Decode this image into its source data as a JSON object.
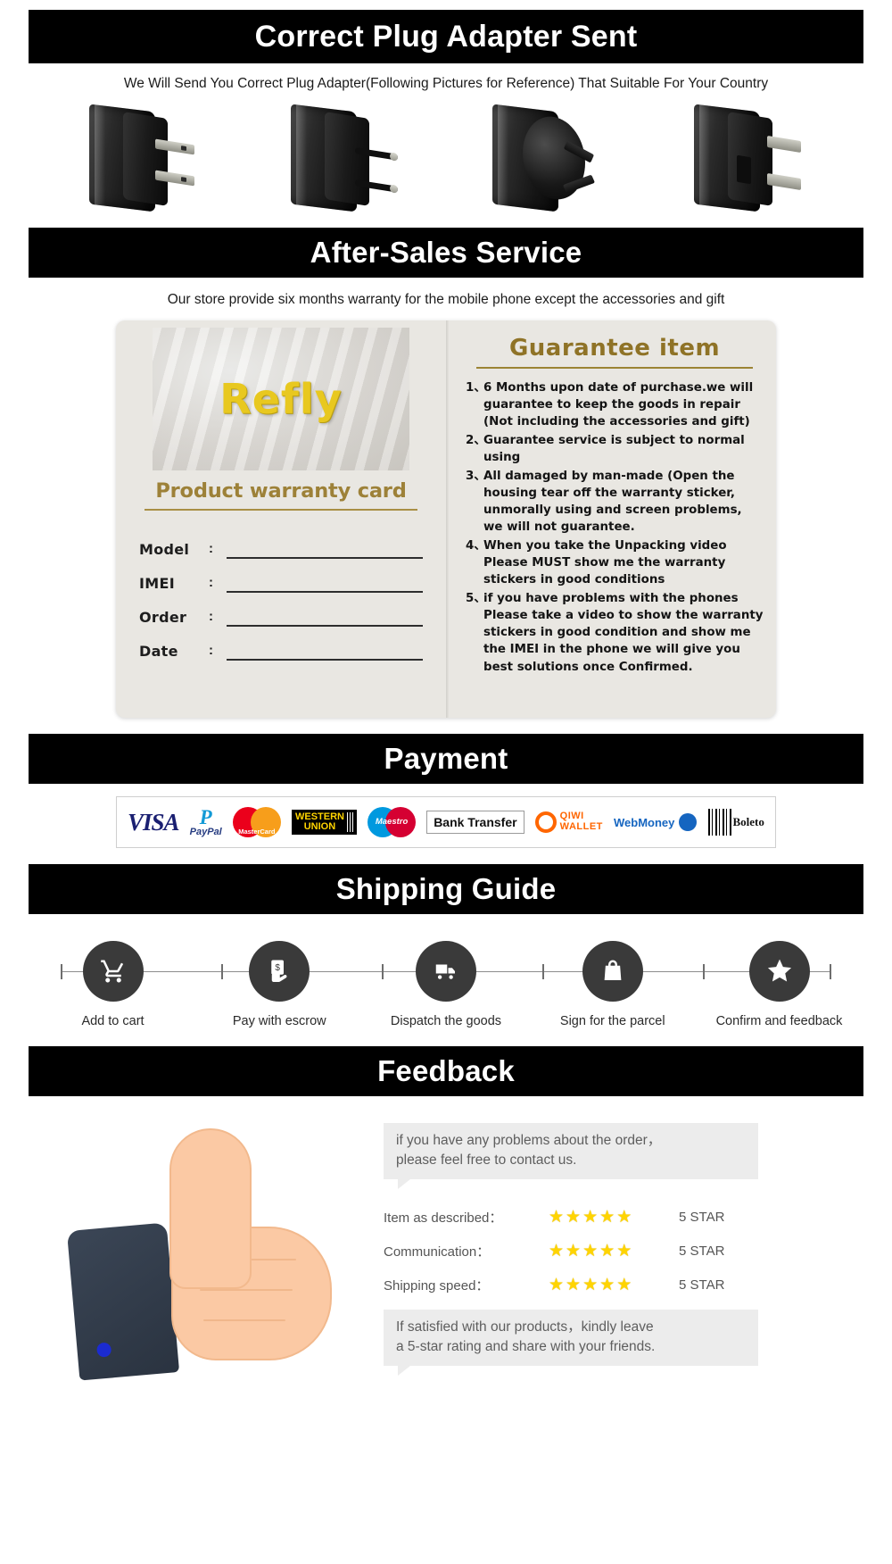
{
  "sections": {
    "plug": {
      "title": "Correct Plug Adapter Sent",
      "subtitle": "We Will Send You Correct Plug Adapter(Following Pictures for Reference) That Suitable For Your Country",
      "adapters": [
        {
          "name": "us-plug-adapter"
        },
        {
          "name": "eu-plug-adapter"
        },
        {
          "name": "au-plug-adapter"
        },
        {
          "name": "uk-plug-adapter"
        }
      ]
    },
    "after_sales": {
      "title": "After-Sales Service",
      "subtitle": "Our store provide  six months warranty  for the mobile  phone  except the  accessories and gift",
      "card": {
        "brand": "Refly",
        "card_title": "Product warranty card",
        "fields": [
          {
            "label": "Model",
            "colon": ":",
            "value": ""
          },
          {
            "label": "IMEI",
            "colon": ":",
            "value": ""
          },
          {
            "label": "Order",
            "colon": ":",
            "value": ""
          },
          {
            "label": "Date",
            "colon": ":",
            "value": ""
          }
        ],
        "guarantee_title": "Guarantee  item",
        "guarantee_items": [
          {
            "num": "1、",
            "text": "6 Months upon date of purchase.we will guarantee to keep the goods in repair (Not including the accessories and gift)"
          },
          {
            "num": "2、",
            "text": "Guarantee service is subject to normal using"
          },
          {
            "num": "3、",
            "text": "All damaged by man-made (Open the housing tear off the warranty sticker, unmorally using and screen problems, we will not guarantee."
          },
          {
            "num": "4、",
            "text": "When you take the Unpacking video Please MUST show me the warranty stickers in good conditions"
          },
          {
            "num": "5、",
            "text": "if you have problems with the phones Please take a video to show the warranty stickers in good condition and show me the IMEI in the phone we will give you best solutions once  Confirmed."
          }
        ]
      }
    },
    "payment": {
      "title": "Payment",
      "methods": [
        {
          "name": "visa-logo",
          "label": "VISA"
        },
        {
          "name": "paypal-logo",
          "label": "PayPal"
        },
        {
          "name": "mastercard-logo",
          "label": "MasterCard"
        },
        {
          "name": "western-union-logo",
          "label": "WESTERN",
          "label2": "UNION"
        },
        {
          "name": "maestro-logo",
          "label": "Maestro"
        },
        {
          "name": "bank-transfer-logo",
          "label": "Bank Transfer"
        },
        {
          "name": "qiwi-wallet-logo",
          "label": "QIWI",
          "label2": "WALLET"
        },
        {
          "name": "webmoney-logo",
          "label": "WebMoney"
        },
        {
          "name": "boleto-logo",
          "label": "Boleto"
        }
      ]
    },
    "shipping": {
      "title": "Shipping Guide",
      "steps": [
        {
          "icon": "shopping-cart-icon",
          "label": "Add to cart"
        },
        {
          "icon": "hand-money-icon",
          "label": "Pay with escrow"
        },
        {
          "icon": "delivery-truck-icon",
          "label": "Dispatch the goods"
        },
        {
          "icon": "shopping-bag-icon",
          "label": "Sign for the parcel"
        },
        {
          "icon": "star-icon",
          "label": "Confirm and feedback"
        }
      ]
    },
    "feedback": {
      "title": "Feedback",
      "bubble_top": "if you have any problems about the order，\nplease feel free to contact us.",
      "ratings": [
        {
          "label": "Item as described：",
          "stars": 5,
          "value": "5 STAR"
        },
        {
          "label": "Communication：",
          "stars": 5,
          "value": "5 STAR"
        },
        {
          "label": "Shipping speed：",
          "stars": 5,
          "value": "5 STAR"
        }
      ],
      "bubble_bottom": "If satisfied with our products，kindly leave\na 5-star rating and share with your friends."
    }
  },
  "colors": {
    "banner_bg": "#000000",
    "banner_text": "#ffffff",
    "gold": "#9d8138",
    "brand_yellow": "#e8c81f",
    "star": "#ffd400"
  }
}
